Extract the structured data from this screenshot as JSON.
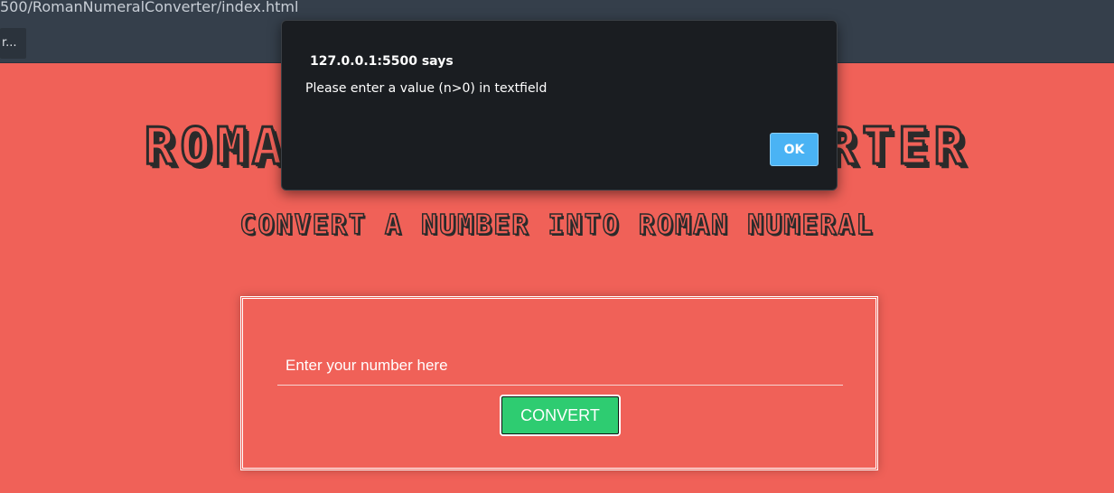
{
  "browser": {
    "url": "500/RomanNumeralConverter/index.html",
    "bookmark_label": "r..."
  },
  "page": {
    "title": "ROMAN NUMERAL CONVERTER",
    "subtitle": "CONVERT A NUMBER INTO ROMAN NUMERAL",
    "input_placeholder": "Enter your number here",
    "input_value": "",
    "convert_label": "CONVERT"
  },
  "alert": {
    "origin": "127.0.0.1:5500 says",
    "message": "Please enter a value (n>0) in textfield",
    "ok_label": "OK"
  },
  "colors": {
    "page_bg": "#f06158",
    "chrome_bg": "#353f4b",
    "convert_button": "#2ecc71",
    "dialog_bg": "#1a1d21",
    "ok_button": "#4ab3f4"
  }
}
